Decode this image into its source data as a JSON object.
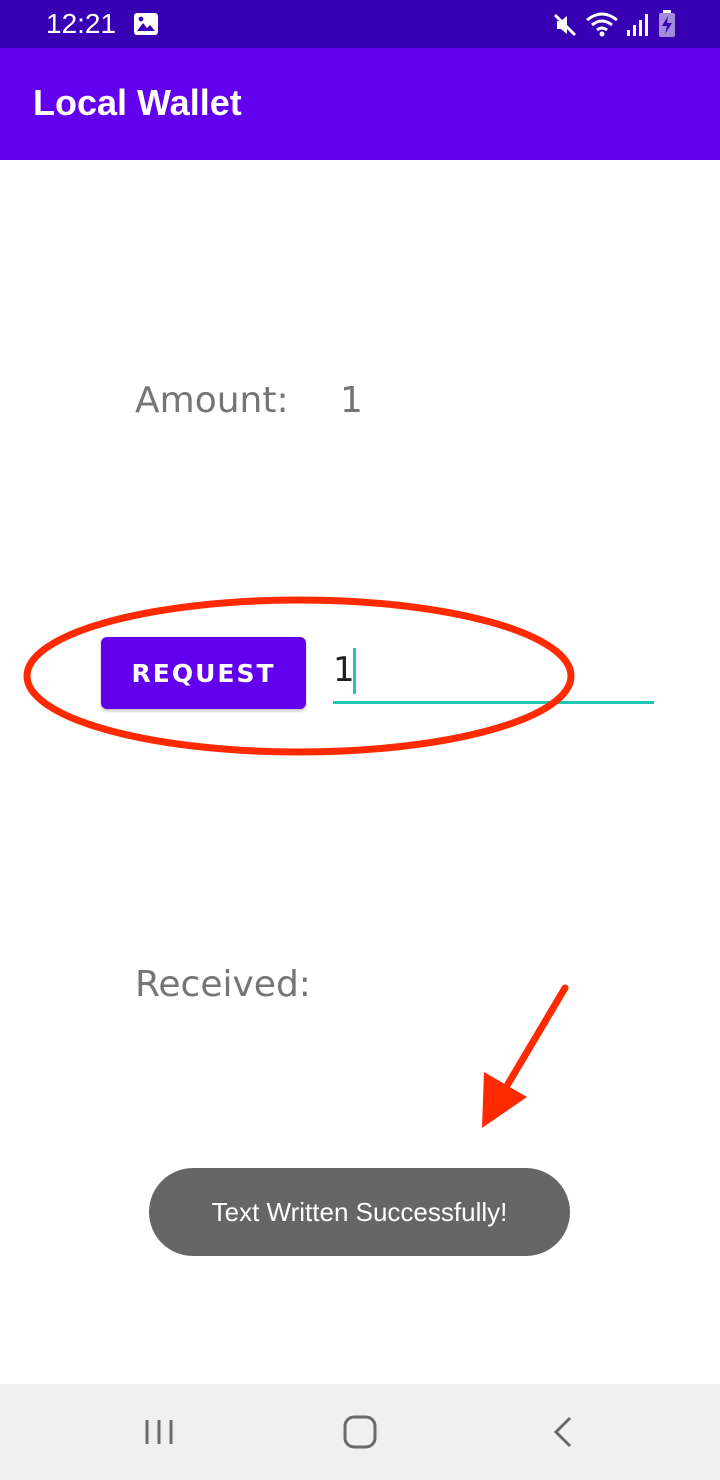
{
  "status_bar": {
    "time": "12:21",
    "background": "#3700b3",
    "icons": [
      "image-icon",
      "mute-icon",
      "wifi-icon",
      "signal-icon",
      "battery-icon"
    ]
  },
  "app_bar": {
    "title": "Local Wallet",
    "background": "#6200ee"
  },
  "main": {
    "amount_label": "Amount:",
    "amount_value": "1",
    "request_button_label": "REQUEST",
    "amount_input_value": "1",
    "received_label": "Received:"
  },
  "toast": {
    "message": "Text Written Successfully!"
  },
  "nav_bar": {
    "icons": [
      "recent-apps-icon",
      "home-icon",
      "back-icon"
    ]
  },
  "colors": {
    "accent": "#6200ee",
    "input_underline": "#1fc7b5",
    "annotation": "#ff2a00"
  }
}
